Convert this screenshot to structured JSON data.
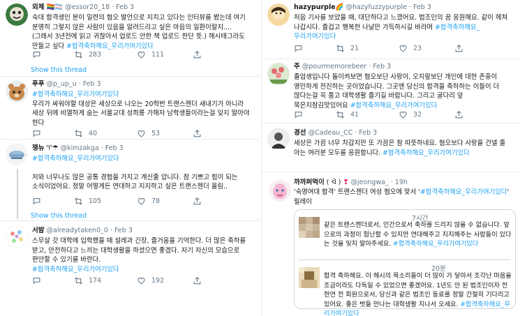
{
  "left": [
    {
      "name": "외체",
      "flags": "🏳️‍🌈🏳️‍⚧️",
      "handle": "@essor20_18",
      "date": "· Feb 3",
      "text": "숙대 합격생인 분이 일련의 혐오 발언으로 지치고 있다는 인터뷰를 봤는데 여기 분명히 그렇지 않은 사람이 있음을 알려드리고 싶은 마음의 일환이랄지.... (그래서 3년전에 읽고 귀찮아서 업로드 안한 책 업로드 한단 뜻.) 해시태그라도 만들고 싶다",
      "hashtag": "#합격축하해요_우리가여기있다",
      "retweets": "283",
      "likes": "111",
      "show": "Show this thread"
    },
    {
      "name": "푸푸",
      "flags": "",
      "handle": "@p_up_u",
      "date": "· Feb 3",
      "hashtag": "#합격축하해요_우리가여기있다",
      "text": "우리가 싸워야할 대상은 세상으로 나오는 20학번 트랜스젠더 새내기가 아니라 세상 뒤에 비열하게 숨는 서울교대 성희롱 가해자 남학생들이라는걸 잊지 말아야 한다",
      "retweets": "40",
      "likes": "53"
    },
    {
      "name": "쟁뉴",
      "flags": "♈☂",
      "handle": "@kimzakga",
      "date": "· Feb 3",
      "hashtag": "#합격축하해요_우리가여기있다",
      "text": "저와 너무나도 많은 공통 경험을 가지고 계신줄 압니다. 참 기쁘고 힘이 되는 소식이었어요. 정말 어떻게든 연대하고 지지하고 싶은 트랜스젠더 올림..",
      "retweets": "105",
      "likes": "78",
      "show": "Show this thread"
    },
    {
      "name": "서밤",
      "flags": "",
      "handle": "@alreadytaken0_0",
      "date": "· Feb 3",
      "text": "스무살 갓 대학에 입학했을 때 설레과 긴장, 즐거움을 기억한다. 더 많은 축하를 받고, 안전하다고 느끼는 대학생활을 하셨으면 좋겠다. 자기 자신의 모습으로 편안할 수 있기를 바란다.",
      "hashtag": "#합격축하해요_우리가여기있다",
      "retweets": "174",
      "likes": "192"
    }
  ],
  "right": [
    {
      "name": "hazypurple",
      "flags": "🌈",
      "handle": "@hazyfuzzypurple",
      "date": "· Feb 3",
      "text": "처음 기사를 보았을 때, 대단하다고 느꼈어요. 법조인의 꿈 응원해요. 같이 헤쳐 나갑시다. 즐겁고 행복한 나날만 가득하시길 바라며",
      "hashtag": "#합격축하해요_우리가여기있다",
      "retweets": "21",
      "likes": "23"
    },
    {
      "name": "주",
      "flags": "",
      "handle": "@pourmemorebeer",
      "date": "· Feb 3",
      "text": "졸업생입니다 돌이켜보면 혐오보단 사랑이, 오지랖보단 개인에 대한 존중이 영민하게 전진하는 곳이었습니다. 그곳엔 당신의 합격을 축하하는 이들이 더 많다는걸 꼭 품고 대학생활 즐기길 바랍니다. 그리고 굴다리 앞 묵은지참김맛있어요",
      "hashtag": "#합격축하해요_우리가여기있다",
      "retweets": "41",
      "likes": "32"
    },
    {
      "name": "경선",
      "flags": "",
      "handle": "@Cadeau_CC",
      "date": "· Feb 3",
      "text": "세상은 가끔 너무 차갑지만 또 가끔은 참 따뜻하네요. 혐오보다 사랑을 건넬 줄 아는 여러분 모두를 응원합니다.",
      "hashtag": "#합격축하해요_우리가여기있다",
      "retweets": "",
      "likes": ""
    },
    {
      "name": "까까퍼먹이",
      "flags": "( ᐛ )",
      "heart": "❣",
      "handle": "@jeongwa_",
      "date": "· 19h",
      "text_pre": "'숙명여대 합격' 트랜스젠더 여성 혐오에 맞서 '",
      "hashtag": "#합격축하해요_우리가여기있다",
      "text_post": "' 릴레이",
      "quotes": [
        {
          "time": "7시간",
          "text": "같은 트랜스젠더로서, 인간으로서 축하를 드리지 않을 수 없습니다. 앞으로의 과정이 험난할 수 있지만 연대해주고 지지해주는 사람들이 있다는 것을 잊지 말아주세요.",
          "hashtag": "#합격축하해요_우리가여기있다"
        },
        {
          "time": "20분",
          "text": "합격 축하해요. 이 해시의 목소리들이 더 많이 가 닿아서 조각난 마음을 조금이라도 다독일 수 있었으면 좋겠어요. 1년도 안 된 법조인이자 전현연 전 회원으로서, 당신과 같은 법조인 동료를 정말 간절히 기다리고 있어요. 좋은 벗들 만나는 대학생활 지나서 오세요.",
          "hashtag": "#합격축하해요_우리가여기있다"
        }
      ]
    }
  ],
  "colors": {
    "accent": "#1da1f2",
    "muted": "#657786",
    "text": "#14171a",
    "border": "#e6ecf0"
  }
}
